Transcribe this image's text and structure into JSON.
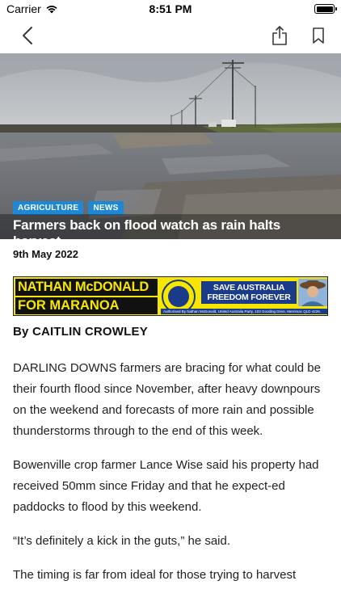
{
  "status_bar": {
    "carrier": "Carrier",
    "time": "8:51 PM"
  },
  "nav": {
    "back_icon": "chevron-left-icon",
    "share_icon": "share-icon",
    "bookmark_icon": "bookmark-icon"
  },
  "article": {
    "tags": [
      "AGRICULTURE",
      "NEWS"
    ],
    "headline": "Farmers back on flood watch as rain halts harvest",
    "date": "9th May 2022",
    "byline": "By CAITLIN CROWLEY",
    "paragraphs": [
      "DARLING DOWNS farmers are bracing for what could be their fourth flood since November, after heavy downpours on the weekend and forecasts of more rain and possible thunderstorms through to the end of this week.",
      "Bowenville crop farmer Lance Wise said his property had received 50mm since Friday and that he expect-ed paddocks to flood by this weekend.",
      "“It’s definitely a kick in the guts,” he said.",
      "The timing is far from ideal for those trying to harvest"
    ]
  },
  "ad": {
    "line1": "NATHAN McDONALD",
    "line2": "FOR MARANOA",
    "slogan1": "SAVE AUSTRALIA",
    "slogan2": "FREEDOM FOREVER",
    "authorised": "Authorised By Nathan McDonald, United Australia Party, 103 Gooding Drive, Merrimac QLD 4226."
  },
  "colors": {
    "tag_bg": "#1e88d4",
    "ad_yellow": "#f6e600",
    "ad_blue": "#1a3a8a"
  }
}
